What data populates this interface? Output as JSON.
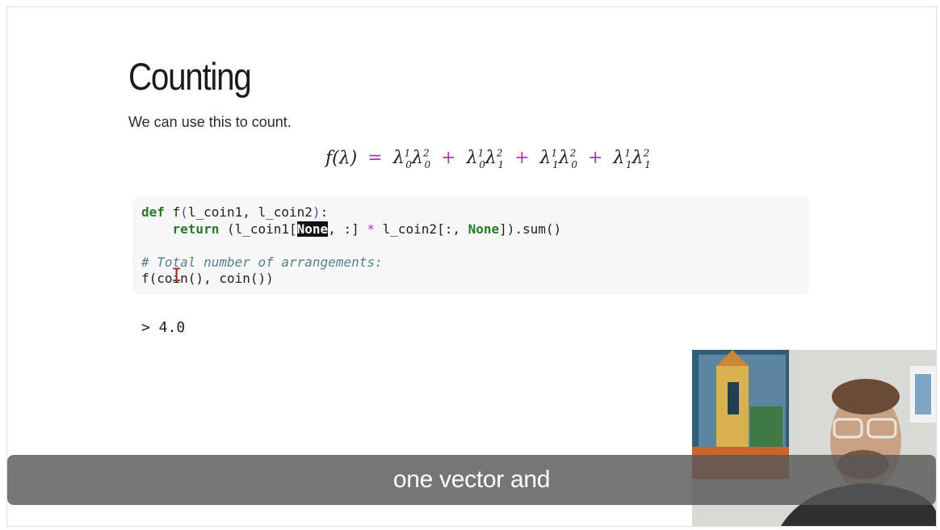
{
  "slide": {
    "title": "Counting",
    "text": "We can use this to count."
  },
  "formula": {
    "lhs": "f(λ)",
    "eq": "=",
    "plus": "+",
    "lambda": "λ"
  },
  "code": {
    "def_kw": "def",
    "fn_sig_a": " f",
    "fn_sig_b": "l_coin1, l_coin2",
    "fn_sig_c": ":",
    "return_kw": "return",
    "ret_a": " (l_coin1[",
    "ret_none1": "None",
    "ret_b": ", :] ",
    "ret_star": "*",
    "ret_c": " l_coin2[:, ",
    "ret_none2": "None",
    "ret_d": "]).sum()",
    "comment": "# Total number of arrangements:",
    "call": "f(coin(), coin())"
  },
  "output": {
    "text": "> 4.0"
  },
  "subtitle": {
    "text": "one vector and"
  },
  "colors": {
    "keyword": "#2a7a2a",
    "comment": "#56808f",
    "subtitle_bg": "#585858"
  },
  "icons": {
    "text_cursor": "i-beam-icon"
  }
}
